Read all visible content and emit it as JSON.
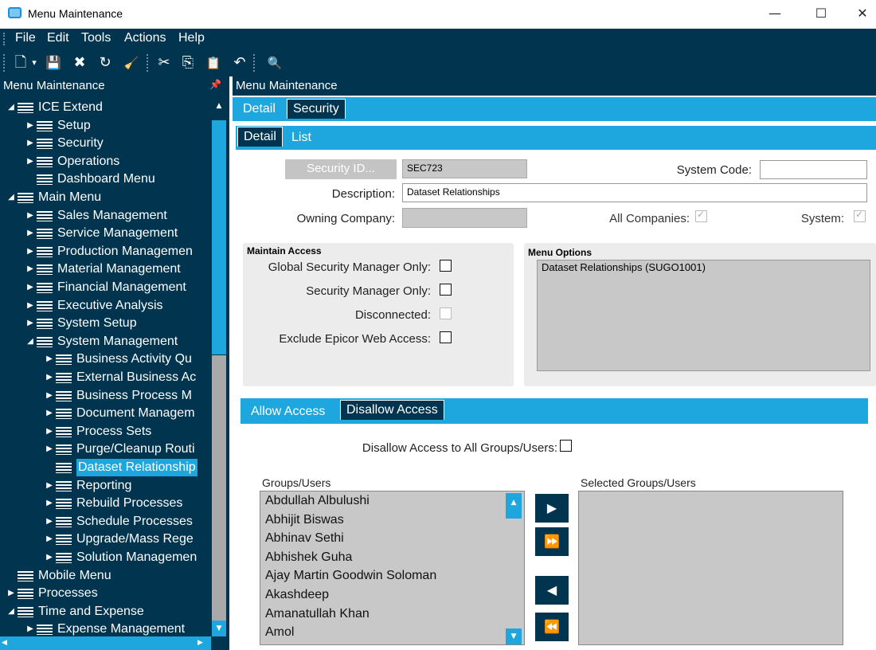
{
  "window": {
    "title": "Menu Maintenance",
    "minimize": "—",
    "maximize": "☐",
    "close": "✕"
  },
  "menubar": [
    "File",
    "Edit",
    "Tools",
    "Actions",
    "Help"
  ],
  "toolbar": {
    "new": "🗋",
    "new_dropdown": "▾",
    "save": "💾",
    "delete": "✖",
    "refresh": "↻",
    "clear": "🧹",
    "cut": "✂",
    "copy": "⎘",
    "paste": "📋",
    "undo": "↶",
    "search": "🔍"
  },
  "left_panel": {
    "title": "Menu Maintenance",
    "pin": "📌"
  },
  "tree": [
    {
      "label": "ICE Extend",
      "level": 0,
      "arrow": "◢"
    },
    {
      "label": "Setup",
      "level": 1,
      "arrow": "▶"
    },
    {
      "label": "Security",
      "level": 1,
      "arrow": "▶"
    },
    {
      "label": "Operations",
      "level": 1,
      "arrow": "▶"
    },
    {
      "label": "Dashboard Menu",
      "level": 1,
      "arrow": ""
    },
    {
      "label": "Main Menu",
      "level": 0,
      "arrow": "◢"
    },
    {
      "label": "Sales Management",
      "level": 1,
      "arrow": "▶"
    },
    {
      "label": "Service Management",
      "level": 1,
      "arrow": "▶"
    },
    {
      "label": "Production Managemen",
      "level": 1,
      "arrow": "▶"
    },
    {
      "label": "Material Management",
      "level": 1,
      "arrow": "▶"
    },
    {
      "label": "Financial Management",
      "level": 1,
      "arrow": "▶"
    },
    {
      "label": "Executive Analysis",
      "level": 1,
      "arrow": "▶"
    },
    {
      "label": "System Setup",
      "level": 1,
      "arrow": "▶"
    },
    {
      "label": "System Management",
      "level": 1,
      "arrow": "◢"
    },
    {
      "label": "Business Activity Qu",
      "level": 2,
      "arrow": "▶"
    },
    {
      "label": "External Business Ac",
      "level": 2,
      "arrow": "▶"
    },
    {
      "label": "Business Process M",
      "level": 2,
      "arrow": "▶"
    },
    {
      "label": "Document Managem",
      "level": 2,
      "arrow": "▶"
    },
    {
      "label": "Process Sets",
      "level": 2,
      "arrow": "▶"
    },
    {
      "label": "Purge/Cleanup Routi",
      "level": 2,
      "arrow": "▶"
    },
    {
      "label": "Dataset Relationship",
      "level": 2,
      "arrow": "",
      "selected": true
    },
    {
      "label": "Reporting",
      "level": 2,
      "arrow": "▶"
    },
    {
      "label": "Rebuild Processes",
      "level": 2,
      "arrow": "▶"
    },
    {
      "label": "Schedule Processes",
      "level": 2,
      "arrow": "▶"
    },
    {
      "label": "Upgrade/Mass Rege",
      "level": 2,
      "arrow": "▶"
    },
    {
      "label": "Solution Managemen",
      "level": 2,
      "arrow": "▶"
    },
    {
      "label": "Mobile Menu",
      "level": 0,
      "arrow": ""
    },
    {
      "label": "Processes",
      "level": 0,
      "arrow": "▶"
    },
    {
      "label": "Time and Expense",
      "level": 0,
      "arrow": "◢"
    },
    {
      "label": "Expense Management",
      "level": 1,
      "arrow": "▶"
    }
  ],
  "scroll": {
    "up": "▲",
    "down": "▼",
    "left": "◀",
    "right": "▶"
  },
  "right_panel": {
    "title": "Menu Maintenance",
    "tabs": [
      "Detail",
      "Security"
    ],
    "subtabs": [
      "Detail",
      "List"
    ],
    "security_id_button": "Security ID...",
    "security_id_value": "SEC723",
    "system_code_label": "System Code:",
    "system_code_value": "",
    "description_label": "Description:",
    "description_value": "Dataset Relationships",
    "owning_company_label": "Owning Company:",
    "owning_company_value": "",
    "all_companies_label": "All Companies:",
    "system_label": "System:",
    "maintain_access": {
      "title": "Maintain Access",
      "global_label": "Global Security Manager Only:",
      "security_manager_label": "Security Manager Only:",
      "disconnected_label": "Disconnected:",
      "exclude_label": "Exclude Epicor Web Access:"
    },
    "menu_options": {
      "title": "Menu Options",
      "value": "Dataset Relationships (SUGO1001)"
    },
    "access_tabs": [
      "Allow Access",
      "Disallow Access"
    ],
    "disallow_all_label": "Disallow Access to All Groups/Users:",
    "groups_label": "Groups/Users",
    "selected_label": "Selected Groups/Users",
    "groups": [
      "Abdullah Albulushi",
      "Abhijit Biswas",
      "Abhinav Sethi",
      "Abhishek Guha",
      "Ajay Martin Goodwin Soloman",
      "Akashdeep",
      "Amanatullah Khan",
      "Amol"
    ],
    "move_buttons": {
      "add": "▶",
      "add_all": "⏩",
      "remove": "◀",
      "remove_all": "⏪"
    }
  }
}
